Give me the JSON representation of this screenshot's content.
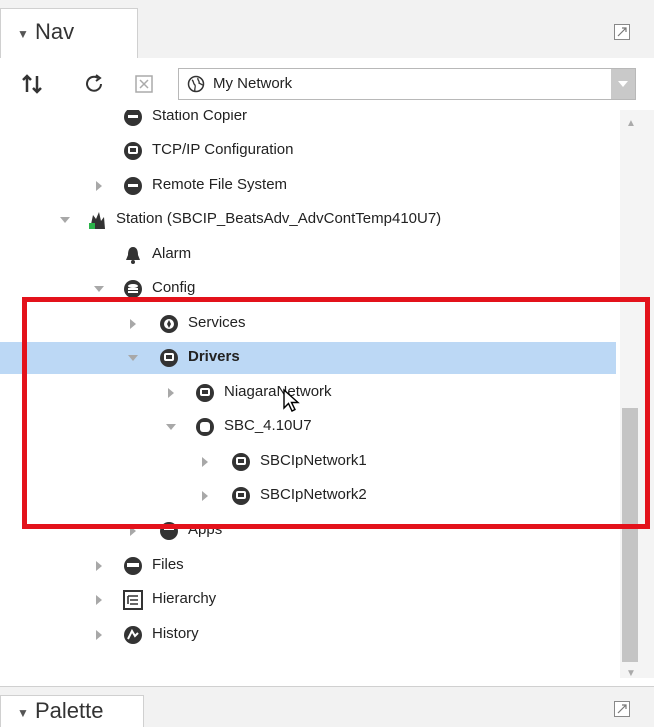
{
  "nav": {
    "tab_label": "Nav"
  },
  "toolbar": {
    "network_select_value": "My Network"
  },
  "tree": {
    "items": [
      {
        "label": "Station Copier",
        "icon": "module-icon",
        "state": "none"
      },
      {
        "label": "TCP/IP Configuration",
        "icon": "service-icon",
        "state": "none"
      },
      {
        "label": "Remote File System",
        "icon": "module-icon",
        "state": "collapsed"
      },
      {
        "label": "Station (SBCIP_BeatsAdv_AdvContTemp410U7)",
        "icon": "station-icon",
        "state": "expanded"
      },
      {
        "label": "Alarm",
        "icon": "bell-icon",
        "state": "none"
      },
      {
        "label": "Config",
        "icon": "database-icon",
        "state": "expanded"
      },
      {
        "label": "Services",
        "icon": "services-icon",
        "state": "collapsed"
      },
      {
        "label": "Drivers",
        "icon": "network-icon",
        "state": "expanded",
        "selected": true
      },
      {
        "label": "NiagaraNetwork",
        "icon": "network-icon",
        "state": "collapsed"
      },
      {
        "label": "SBC_4.10U7",
        "icon": "device-icon",
        "state": "expanded"
      },
      {
        "label": "SBCIpNetwork1",
        "icon": "network-icon",
        "state": "collapsed"
      },
      {
        "label": "SBCIpNetwork2",
        "icon": "network-icon",
        "state": "collapsed"
      },
      {
        "label": "Apps",
        "icon": "apps-icon",
        "state": "collapsed"
      },
      {
        "label": "Files",
        "icon": "files-icon",
        "state": "collapsed"
      },
      {
        "label": "Hierarchy",
        "icon": "hierarchy-icon",
        "state": "collapsed"
      },
      {
        "label": "History",
        "icon": "history-icon",
        "state": "collapsed"
      }
    ]
  },
  "palette": {
    "tab_label": "Palette"
  },
  "colors": {
    "selection": "#bcd8f5",
    "highlight_border": "#e3121b"
  }
}
